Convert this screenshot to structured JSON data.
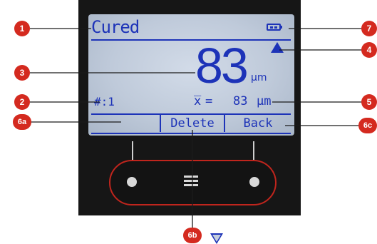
{
  "display": {
    "status_title": "Cured",
    "reading_value": "83",
    "reading_unit": "μm",
    "reading_count": "#:1",
    "mean_symbol": "x̅",
    "mean_equals": "=",
    "mean_value": "83",
    "mean_unit": "μm",
    "softkeys": {
      "left_icon": "down-triangle-icon",
      "middle": "Delete",
      "right": "Back"
    },
    "battery_icon": "battery-icon",
    "trend_icon": "up-triangle-icon"
  },
  "keypad": {
    "left_key_icon": "dot-icon",
    "menu_key_icon": "menu-icon",
    "right_key_icon": "dot-icon"
  },
  "callouts": {
    "c1": "1",
    "c2": "2",
    "c3": "3",
    "c4": "4",
    "c5": "5",
    "c6a": "6a",
    "c6b": "6b",
    "c6c": "6c",
    "c7": "7"
  },
  "colors": {
    "lcd_text": "#1d33b8",
    "callout": "#d42a1f",
    "keypad_ring": "#c0251d"
  }
}
